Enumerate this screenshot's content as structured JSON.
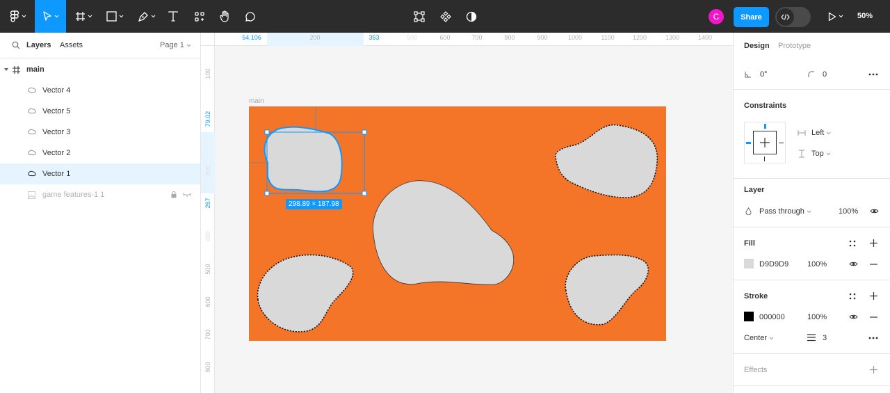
{
  "toolbar": {
    "share_label": "Share",
    "avatar_initial": "C",
    "zoom": "50%"
  },
  "layers_panel": {
    "tabs": [
      "Layers",
      "Assets"
    ],
    "page_selector": "Page 1",
    "root": "main",
    "layers": [
      {
        "name": "Vector 4",
        "selected": false
      },
      {
        "name": "Vector 5",
        "selected": false
      },
      {
        "name": "Vector 3",
        "selected": false
      },
      {
        "name": "Vector 2",
        "selected": false
      },
      {
        "name": "Vector 1",
        "selected": true
      },
      {
        "name": "game features-1 1",
        "selected": false,
        "hidden": true,
        "locked": true
      }
    ]
  },
  "rulers": {
    "top": [
      "54.106",
      "200",
      "353",
      "500",
      "600",
      "700",
      "800",
      "900",
      "1000",
      "1100",
      "1200",
      "1300",
      "1400"
    ],
    "left": [
      "100",
      "79.02",
      "200",
      "267",
      "400",
      "500",
      "600",
      "700",
      "800"
    ]
  },
  "canvas": {
    "frame_label": "main",
    "frame_color": "#f47428",
    "shape_fill": "#d9d9d9",
    "selection_size": "298.89 × 187.98"
  },
  "design_panel": {
    "tabs": [
      "Design",
      "Prototype"
    ],
    "rotation": "0°",
    "corner_radius": "0",
    "constraints": {
      "title": "Constraints",
      "horizontal": "Left",
      "vertical": "Top"
    },
    "layer": {
      "title": "Layer",
      "blend": "Pass through",
      "opacity": "100%"
    },
    "fill": {
      "title": "Fill",
      "hex": "D9D9D9",
      "opacity": "100%",
      "color": "#d9d9d9"
    },
    "stroke": {
      "title": "Stroke",
      "hex": "000000",
      "opacity": "100%",
      "color": "#000000",
      "position": "Center",
      "weight": "3"
    },
    "effects": {
      "title": "Effects"
    }
  },
  "colors": {
    "accent": "#0d99ff",
    "toolbar_bg": "#2c2c2c"
  }
}
